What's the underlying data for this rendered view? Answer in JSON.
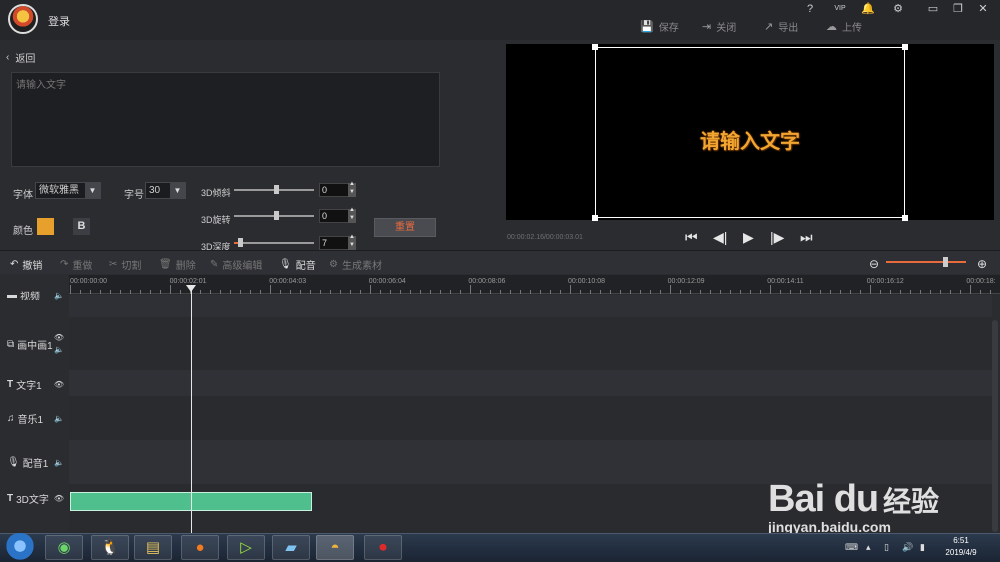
{
  "titlebar": {
    "login_label": "登录",
    "window_controls": [
      "?",
      "VIP",
      "🔔",
      "⚙",
      "▭",
      "❐",
      "✕"
    ],
    "actions": [
      {
        "icon": "save-icon",
        "label": "保存"
      },
      {
        "icon": "close-icon",
        "label": "关闭"
      },
      {
        "icon": "export-icon",
        "label": "导出"
      },
      {
        "icon": "upload-icon",
        "label": "上传"
      }
    ]
  },
  "editor": {
    "back_label": "返回",
    "text_placeholder": "请输入文字",
    "font_label": "字体",
    "font_value": "微软雅黑",
    "size_label": "字号",
    "size_value": "30",
    "color_label": "颜色",
    "bold_label": "B",
    "tilt_label": "3D倾斜",
    "tilt_value": "0",
    "rotate_label": "3D旋转",
    "rotate_value": "0",
    "depth_label": "3D深度",
    "depth_value": "7",
    "reset_label": "重置",
    "accent_color": "#e8a02c"
  },
  "preview": {
    "text": "请输入文字",
    "timecode": "00:00:02.16/00:00:03.01",
    "controls": [
      "skip-start-icon",
      "step-back-icon",
      "play-icon",
      "step-forward-icon",
      "skip-end-icon"
    ]
  },
  "toolbar": {
    "undo": "撤销",
    "redo": "重做",
    "cut": "切割",
    "delete": "删除",
    "advanced": "高级编辑",
    "dub": "配音",
    "generate": "生成素材"
  },
  "ruler": {
    "ticks": [
      "00:00:00:00",
      "00:00:02:01",
      "00:00:04:03",
      "00:00:06:04",
      "00:00:08:06",
      "00:00:10:08",
      "00:00:12:09",
      "00:00:14:11",
      "00:00:16:12",
      "00:00:18:"
    ]
  },
  "tracks": {
    "video": "视频",
    "pip": "画中画1",
    "text": "文字1",
    "music": "音乐1",
    "dub": "配音1",
    "text3d": "3D文字"
  },
  "taskbar": {
    "time": "6:51",
    "date": "2019/4/9"
  },
  "watermark": {
    "brand": "Bai du",
    "cn": "经验",
    "url": "jingyan.baidu.com"
  }
}
